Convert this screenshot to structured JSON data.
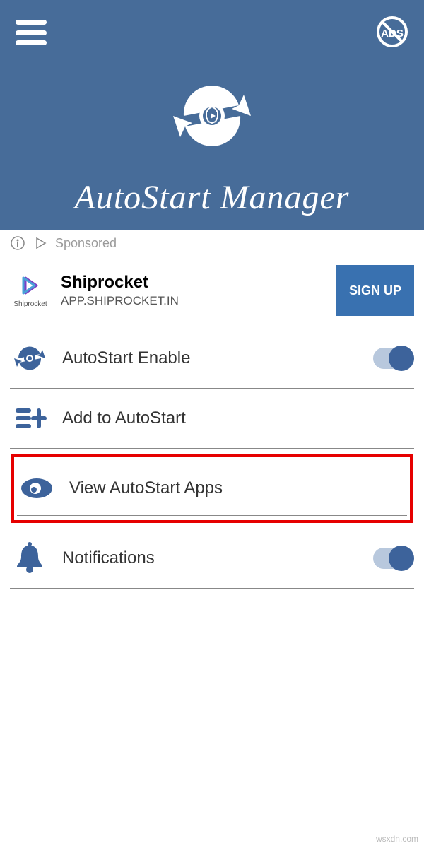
{
  "header": {
    "title": "AutoStart Manager"
  },
  "sponsored": {
    "label": "Sponsored"
  },
  "ad": {
    "app_label": "Shiprocket",
    "title": "Shiprocket",
    "subtitle": "APP.SHIPROCKET.IN",
    "button": "SIGN UP"
  },
  "menu": {
    "autostart_enable": "AutoStart Enable",
    "add_to_autostart": "Add to AutoStart",
    "view_apps": "View AutoStart Apps",
    "notifications": "Notifications"
  },
  "watermark": "wsxdn.com"
}
